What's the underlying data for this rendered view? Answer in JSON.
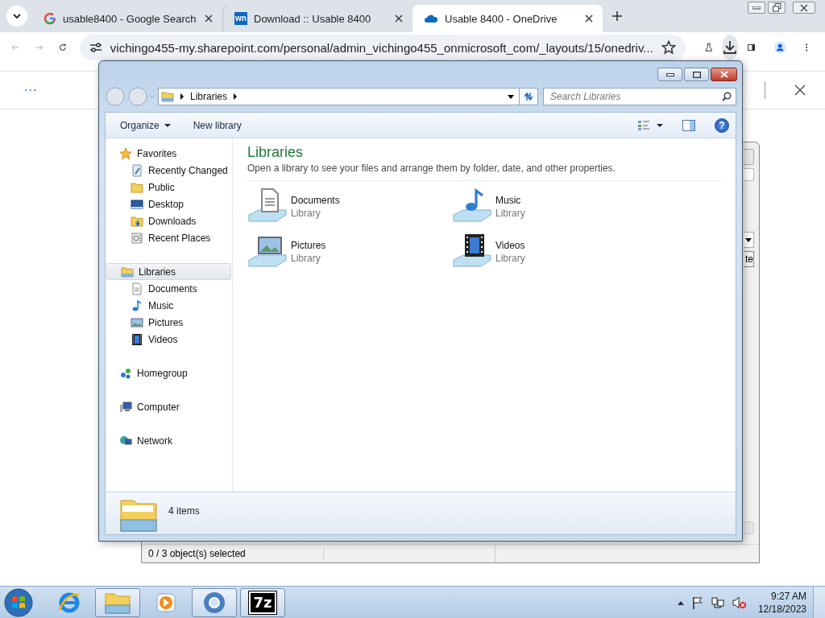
{
  "browser": {
    "tabs": [
      {
        "kind": "google",
        "title": "usable8400 - Google Search",
        "selected": false
      },
      {
        "kind": "badge",
        "badge": "wn",
        "title": "Download :: Usable 8400",
        "selected": false
      },
      {
        "kind": "onedrive",
        "title": "Usable 8400 - OneDrive",
        "selected": true
      }
    ],
    "address": "vichingo455-my.sharepoint.com/personal/admin_vichingo455_onmicrosoft_com/_layouts/15/onedriv...",
    "page_menu": "..."
  },
  "background_dialog": {
    "button_text": "te",
    "status": "0 / 3 object(s) selected"
  },
  "explorer": {
    "breadcrumb": [
      "Libraries"
    ],
    "search": {
      "placeholder": "Search Libraries"
    },
    "commands": [
      {
        "label": "Organize",
        "dropdown": true
      },
      {
        "label": "New library",
        "dropdown": false
      }
    ],
    "help": "?",
    "nav": [
      {
        "label": "Favorites",
        "kind": "star",
        "selected": false,
        "children": [
          {
            "label": "Recently Changed",
            "kind": "recent",
            "selected": false
          },
          {
            "label": "Public",
            "kind": "folder",
            "selected": false
          },
          {
            "label": "Desktop",
            "kind": "desktop",
            "selected": false
          },
          {
            "label": "Downloads",
            "kind": "downloads",
            "selected": false
          },
          {
            "label": "Recent Places",
            "kind": "places",
            "selected": false
          }
        ]
      },
      {
        "label": "Libraries",
        "kind": "library",
        "selected": true,
        "children": [
          {
            "label": "Documents",
            "kind": "document",
            "selected": false
          },
          {
            "label": "Music",
            "kind": "music",
            "selected": false
          },
          {
            "label": "Pictures",
            "kind": "pictures",
            "selected": false
          },
          {
            "label": "Videos",
            "kind": "videos",
            "selected": false
          }
        ]
      },
      {
        "label": "Homegroup",
        "kind": "homegroup",
        "selected": false
      },
      {
        "label": "Computer",
        "kind": "computer",
        "selected": false
      },
      {
        "label": "Network",
        "kind": "network",
        "selected": false
      }
    ],
    "heading": "Libraries",
    "description": "Open a library to see your files and arrange them by folder, date, and other properties.",
    "libraries": [
      {
        "name": "Documents",
        "type": "Library",
        "kind": "document"
      },
      {
        "name": "Music",
        "type": "Library",
        "kind": "music"
      },
      {
        "name": "Pictures",
        "type": "Library",
        "kind": "pictures"
      },
      {
        "name": "Videos",
        "type": "Library",
        "kind": "videos"
      }
    ],
    "details": "4 items"
  },
  "taskbar": {
    "apps": [
      {
        "kind": "ie",
        "running": false
      },
      {
        "kind": "explorer",
        "running": true
      },
      {
        "kind": "media",
        "running": false
      },
      {
        "kind": "chrome",
        "running": true
      },
      {
        "kind": "sevenzip",
        "label": "7z",
        "running": true
      }
    ],
    "clock": {
      "time": "9:27 AM",
      "date": "12/18/2023"
    }
  }
}
